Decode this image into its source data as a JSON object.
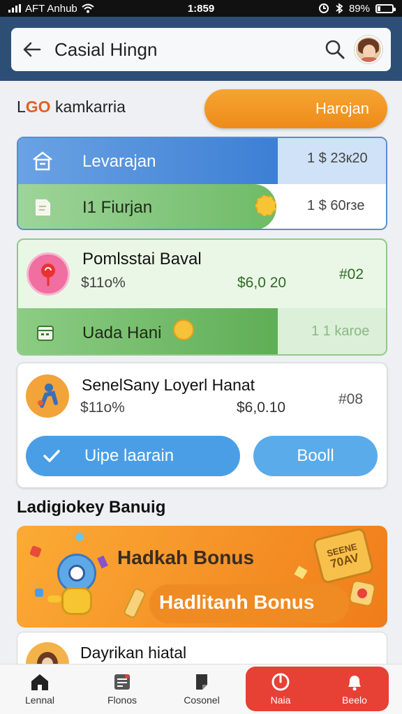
{
  "status": {
    "carrier": "AFT Anhub",
    "time": "1:859",
    "battery": "89%"
  },
  "header": {
    "title": "Casial Hingn"
  },
  "section": {
    "logo_prefix": "L",
    "logo_mark": "GO",
    "title": "kamkarria",
    "action_label": "Harojan"
  },
  "card1": {
    "row1": {
      "label": "Levarajan",
      "value": "1 $ 23к20"
    },
    "row2": {
      "label": "I1 Fiurjan",
      "value": "1 $ 60rзe"
    }
  },
  "card2": {
    "title": "Pomlsstai Baval",
    "percent": "$11o%",
    "amount": "$6,0 20",
    "code": "#02",
    "row_label": "Uada Hani",
    "row_value": "1 1 karoe"
  },
  "card3": {
    "title": "SenelSany Loyerl Hanat",
    "percent": "$11o%",
    "amount": "$6,0.10",
    "code": "#08",
    "primary_label": "Uipe laarain",
    "secondary_label": "Booll"
  },
  "promo": {
    "heading": "Ladigiokey Banuig",
    "line1": "Hadkah Bonus",
    "line2": "Hadlitanh Bonus",
    "ticket_line1": "SEENE",
    "ticket_line2": "70AV"
  },
  "card4": {
    "title": "Dayrikan hiatal"
  },
  "tabs": [
    {
      "label": "Lennal"
    },
    {
      "label": "Flonos"
    },
    {
      "label": "Cosonel"
    },
    {
      "label": "Naia"
    },
    {
      "label": "Beelo"
    }
  ],
  "colors": {
    "appbar": "#2d4f76",
    "accent_orange": "#f39a28",
    "accent_blue": "#3d7fd4",
    "accent_green": "#6ebb66",
    "active_tab": "#e74035"
  },
  "icons": [
    "back-arrow-icon",
    "search-icon",
    "home-icon",
    "document-icon",
    "calendar-icon",
    "check-icon",
    "bell-icon",
    "power-icon"
  ]
}
